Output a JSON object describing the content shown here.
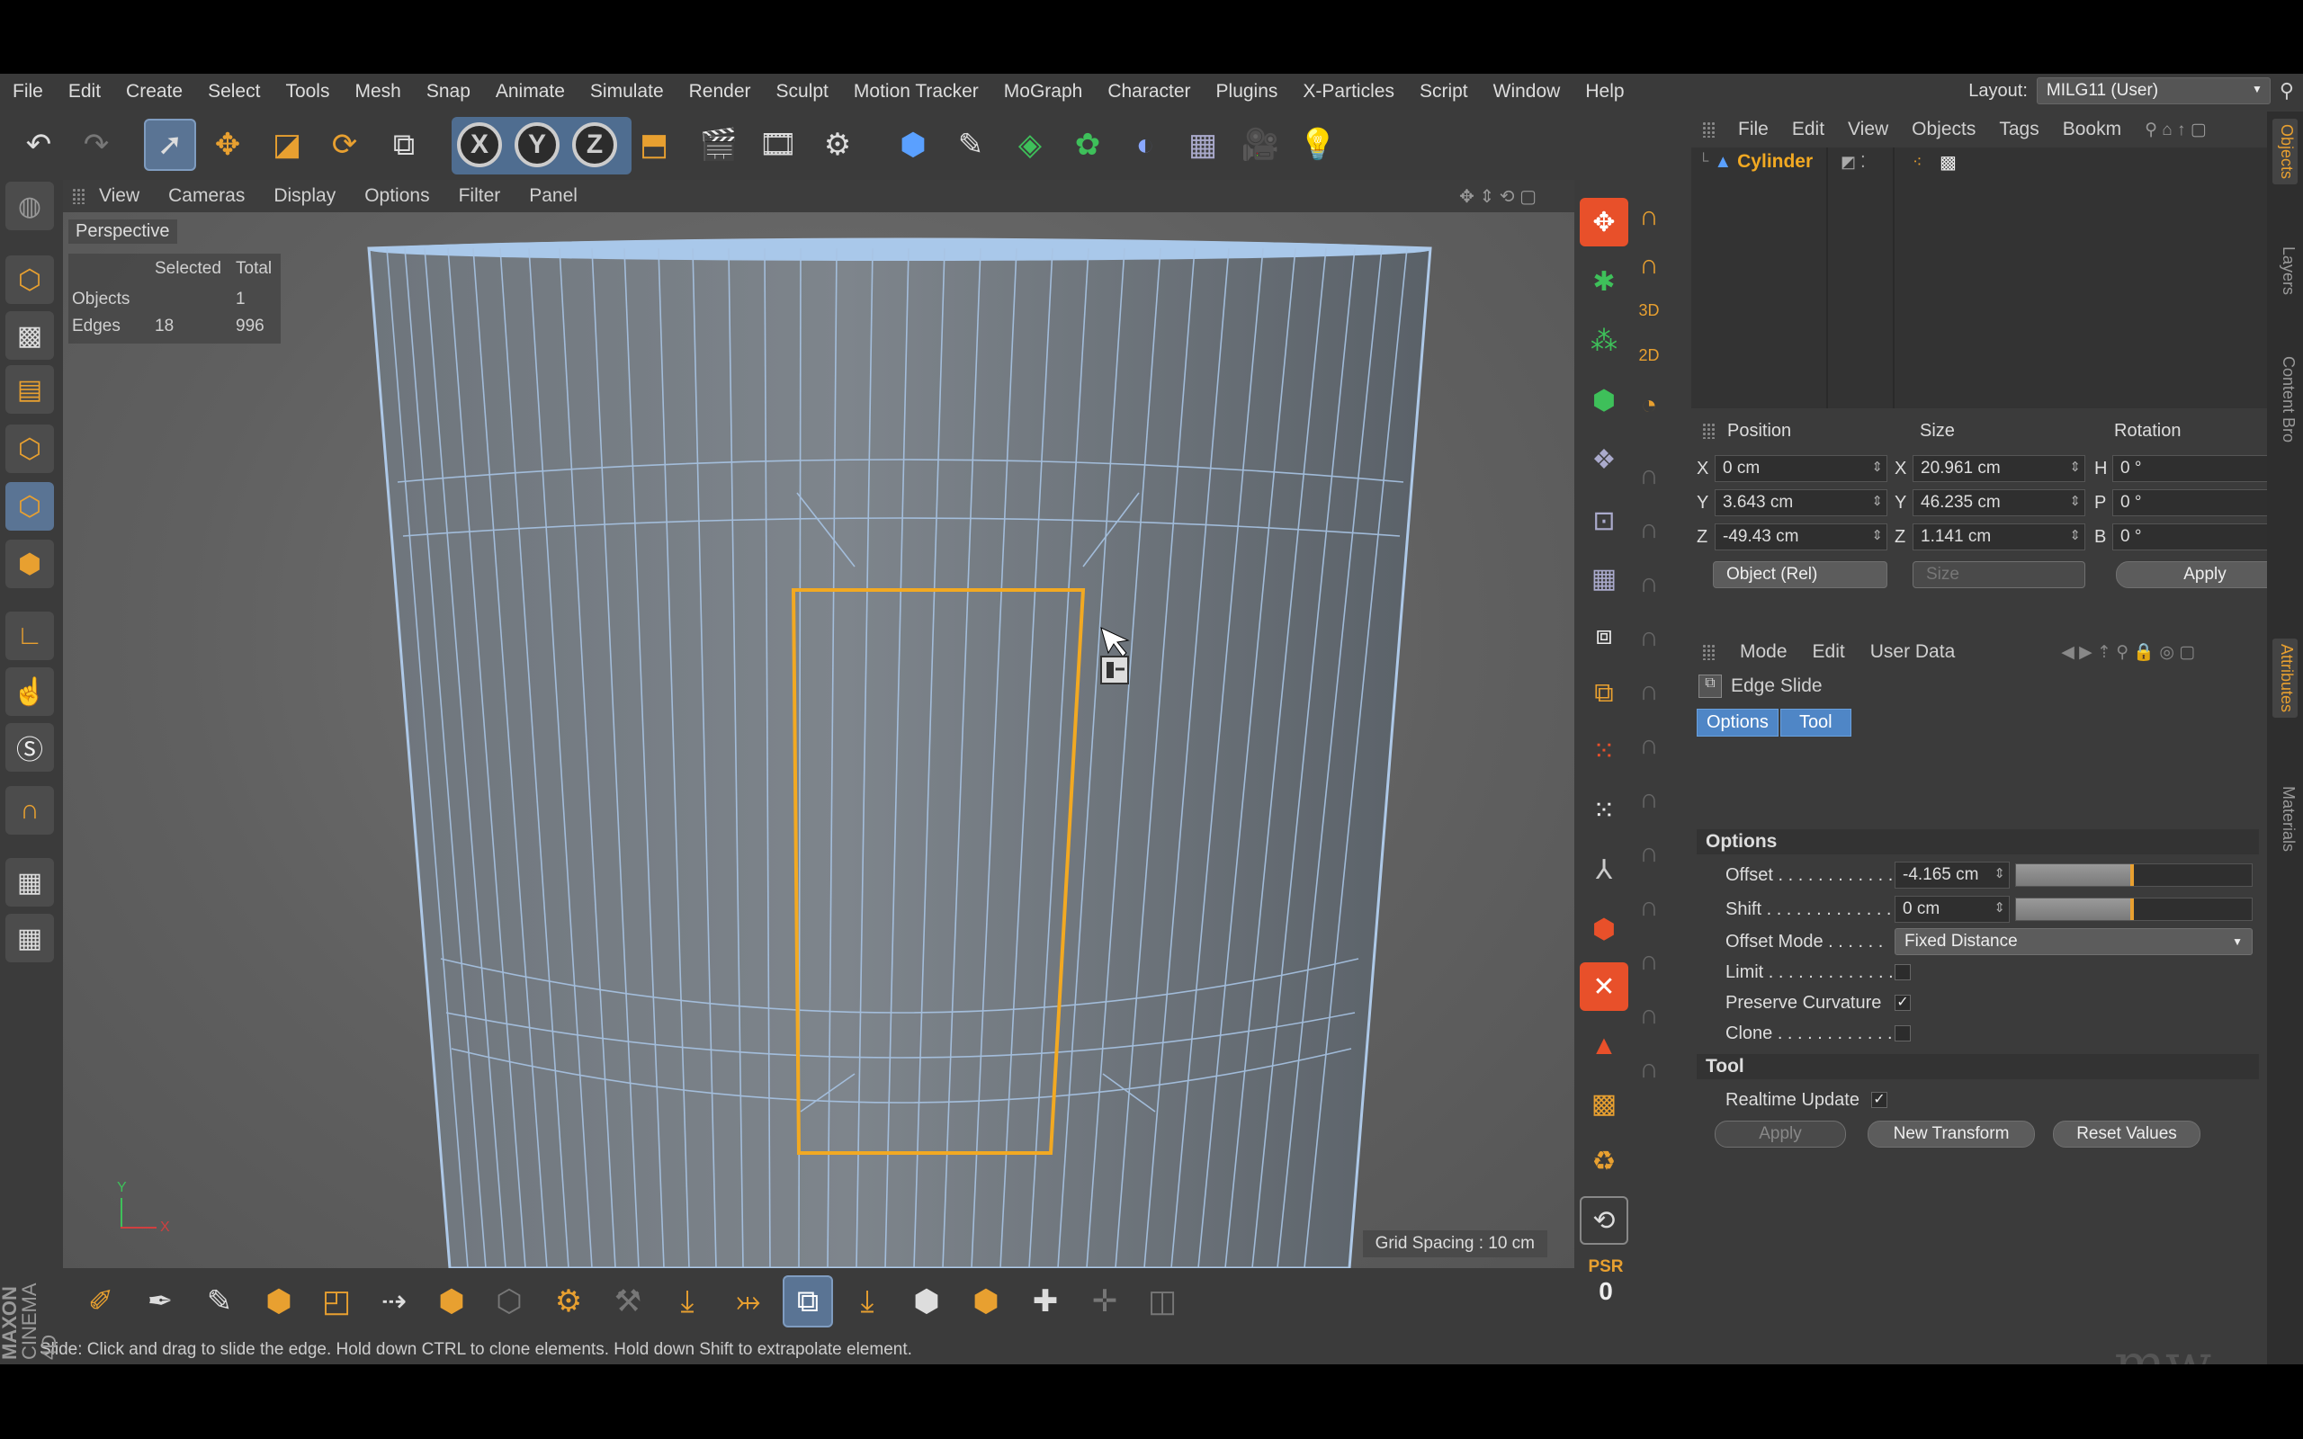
{
  "menu": [
    "File",
    "Edit",
    "Create",
    "Select",
    "Tools",
    "Mesh",
    "Snap",
    "Animate",
    "Simulate",
    "Render",
    "Sculpt",
    "Motion Tracker",
    "MoGraph",
    "Character",
    "Plugins",
    "X-Particles",
    "Script",
    "Window",
    "Help"
  ],
  "layout": {
    "label": "Layout:",
    "value": "MILG11 (User)"
  },
  "toolbar": {
    "x": "X",
    "y": "Y",
    "z": "Z"
  },
  "viewport": {
    "menu": [
      "View",
      "Cameras",
      "Display",
      "Options",
      "Filter",
      "Panel"
    ],
    "label": "Perspective",
    "hud": {
      "col1": "Selected",
      "col2": "Total",
      "row1_label": "Objects",
      "row1_total": "1",
      "row2_label": "Edges",
      "row2_sel": "18",
      "row2_total": "996"
    },
    "grid_spacing": "Grid Spacing : 10 cm",
    "axis_x": "X",
    "axis_y": "Y"
  },
  "status": "Slide: Click and drag to slide the edge. Hold down CTRL to clone elements. Hold down Shift to extrapolate element.",
  "brand": {
    "maxon": "MAXON",
    "cinema": "CINEMA 4D"
  },
  "psr": {
    "label": "PSR",
    "value": "0"
  },
  "objects_panel": {
    "menu": [
      "File",
      "Edit",
      "View",
      "Objects",
      "Tags",
      "Bookm"
    ],
    "object_name": "Cylinder"
  },
  "coords": {
    "headers": {
      "position": "Position",
      "size": "Size",
      "rotation": "Rotation"
    },
    "axes": {
      "x": "X",
      "y": "Y",
      "z": "Z",
      "h": "H",
      "p": "P",
      "b": "B"
    },
    "pos": {
      "x": "0 cm",
      "y": "3.643 cm",
      "z": "-49.43 cm"
    },
    "size": {
      "x": "20.961 cm",
      "y": "46.235 cm",
      "z": "1.141 cm"
    },
    "rot": {
      "h": "0 °",
      "p": "0 °",
      "b": "0 °"
    },
    "mode": "Object (Rel)",
    "size_mode": "Size",
    "apply": "Apply"
  },
  "attributes": {
    "menu": [
      "Mode",
      "Edit",
      "User Data"
    ],
    "tool_name": "Edge Slide",
    "tabs": [
      "Options",
      "Tool"
    ],
    "options_title": "Options",
    "offset_label": "Offset . . . . . . . . . . . . .",
    "offset_value": "-4.165 cm",
    "offset_fill": 0.5,
    "shift_label": "Shift . . . . . . . . . . . . . .",
    "shift_value": "0 cm",
    "shift_fill": 0.5,
    "offset_mode_label": "Offset Mode . . . . . .",
    "offset_mode_value": "Fixed Distance",
    "limit_label": "Limit . . . . . . . . . . . . . .",
    "limit": "",
    "preserve_label": "Preserve Curvature",
    "preserve": "✓",
    "clone_label": "Clone . . . . . . . . . . . . .",
    "clone": "",
    "tool_title": "Tool",
    "realtime_label": "Realtime Update",
    "realtime": "✓",
    "buttons": [
      "Apply",
      "New Transform",
      "Reset Values"
    ]
  },
  "side_tabs": [
    "Objects",
    "Layers",
    "Content Bro",
    "Attributes",
    "Materials"
  ],
  "watermark": "mw"
}
